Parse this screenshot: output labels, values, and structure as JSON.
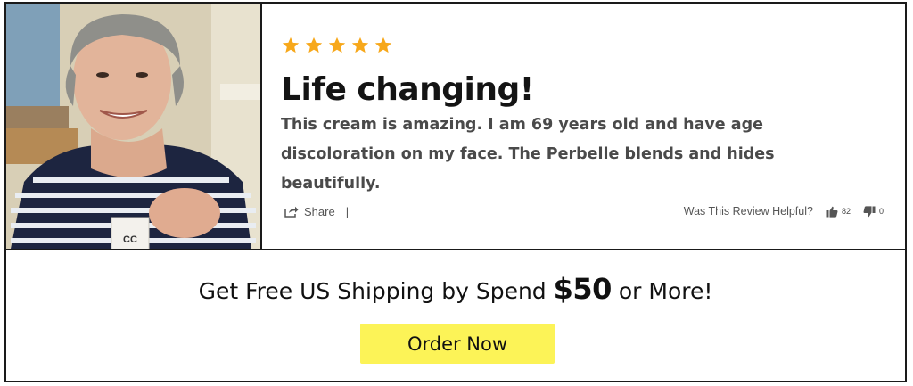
{
  "review": {
    "rating": 5,
    "rating_max": 5,
    "star_color": "#f7a81b",
    "headline": "Life changing!",
    "body": "This cream is amazing. I am 69 years old and have age discoloration on my face. The Perbelle blends and hides beautifully.",
    "share_label": "Share",
    "share_divider": "|",
    "helpful_label": "Was This Review Helpful?",
    "thumbs_up_count": "82",
    "thumbs_down_count": "0"
  },
  "photo": {
    "product_label": "CC"
  },
  "promo": {
    "text_before": "Get Free US Shipping by Spend ",
    "amount": "$50",
    "text_after": " or More!",
    "button_label": "Order Now",
    "button_color": "#fcf357"
  }
}
